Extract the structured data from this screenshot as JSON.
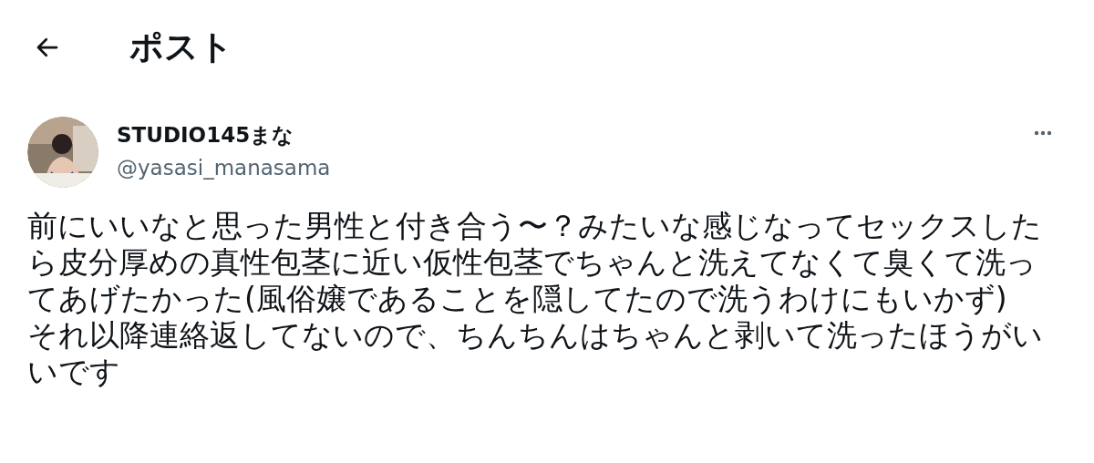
{
  "header": {
    "title": "ポスト"
  },
  "post": {
    "display_name": "STUDIO145まな",
    "handle": "@yasasi_manasama",
    "text": "前にいいなと思った男性と付き合う〜？みたいな感じなってセックスしたら皮分厚めの真性包茎に近い仮性包茎でちゃんと洗えてなくて臭くて洗ってあげたかった(風俗嬢であることを隠してたので洗うわけにもいかず)\nそれ以降連絡返してないので、ちんちんはちゃんと剥いて洗ったほうがいいです"
  }
}
